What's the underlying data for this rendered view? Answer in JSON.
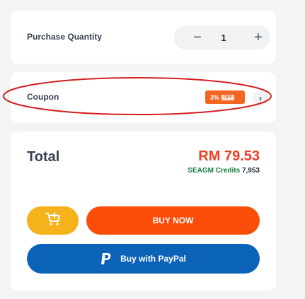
{
  "quantity": {
    "label": "Purchase Quantity",
    "minus_symbol": "−",
    "value": "1",
    "plus_symbol": "+"
  },
  "coupon": {
    "label": "Coupon",
    "badge_percent": "3%",
    "badge_off": "OFF",
    "chevron_symbol": "›",
    "annotation_color": "#d42020"
  },
  "total": {
    "label": "Total",
    "price": "RM 79.53",
    "credits_label": "SEAGM Credits",
    "credits_value": "7,953"
  },
  "actions": {
    "cart_icon": "add-to-cart-icon",
    "buy_now_label": "BUY NOW",
    "paypal_icon": "paypal-icon",
    "paypal_label": "Buy with PayPal"
  },
  "colors": {
    "price": "#ef3e24",
    "credits": "#15803d",
    "coupon_badge": "#f26522",
    "cart_button": "#f5b21a",
    "buy_now_button": "#fa4d0a",
    "paypal_button": "#0b63b8"
  }
}
